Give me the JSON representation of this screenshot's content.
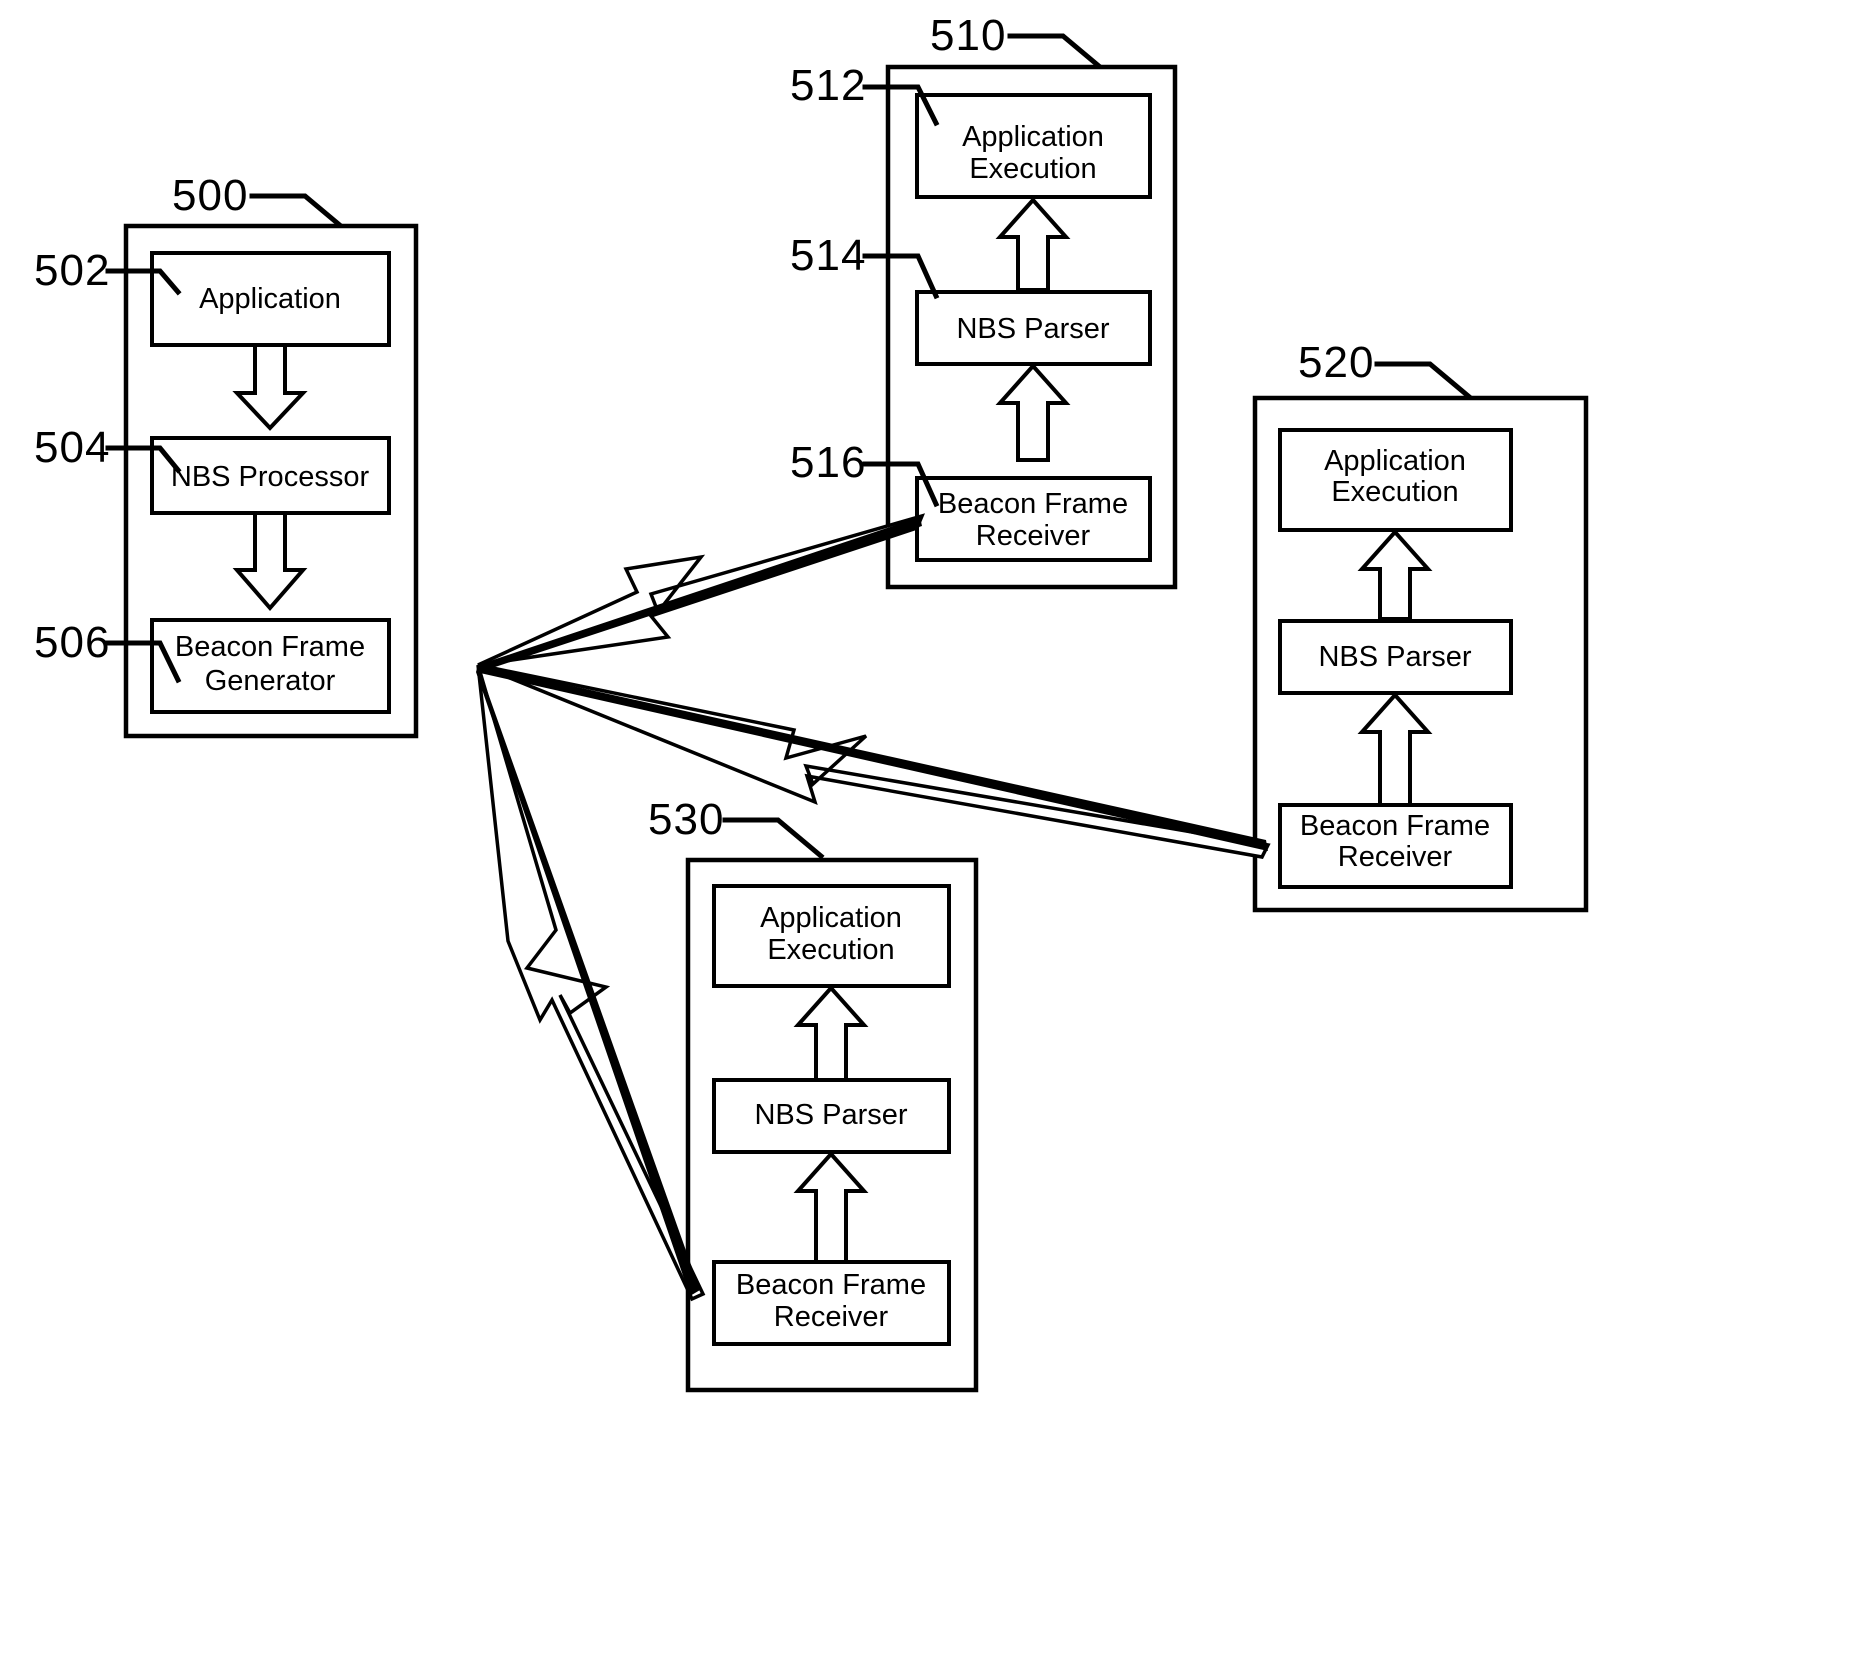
{
  "figure": {
    "title": "Beacon frame based network broadcast system diagram",
    "background_color": "#ffffff",
    "line_color": "#000000"
  },
  "nodes": {
    "transmitter": {
      "ref": "500",
      "children": [
        {
          "ref": "502",
          "label": "Application"
        },
        {
          "ref": "504",
          "label": "NBS  Processor"
        },
        {
          "ref": "506",
          "label_line1": "Beacon Frame",
          "label_line2": "Generator"
        }
      ]
    },
    "receiver_a": {
      "ref": "510",
      "children": [
        {
          "ref": "512",
          "label_line1": "Application",
          "label_line2": "Execution"
        },
        {
          "ref": "514",
          "label": "NBS Parser"
        },
        {
          "ref": "516",
          "label_line1": "Beacon Frame",
          "label_line2": "Receiver"
        }
      ]
    },
    "receiver_b": {
      "ref": "520",
      "children": [
        {
          "label_line1": "Application",
          "label_line2": "Execution"
        },
        {
          "label": "NBS Parser"
        },
        {
          "label_line1": "Beacon Frame",
          "label_line2": "Receiver"
        }
      ]
    },
    "receiver_c": {
      "ref": "530",
      "children": [
        {
          "label_line1": "Application",
          "label_line2": "Execution"
        },
        {
          "label": "NBS Parser"
        },
        {
          "label_line1": "Beacon Frame",
          "label_line2": "Receiver"
        }
      ]
    }
  },
  "wireless_links": [
    {
      "from": "506",
      "to": "516",
      "style": "lightning-bolt"
    },
    {
      "from": "506",
      "to": "520-beacon-frame-receiver",
      "style": "lightning-bolt"
    },
    {
      "from": "506",
      "to": "530-beacon-frame-receiver",
      "style": "lightning-bolt"
    }
  ],
  "internal_flows": [
    {
      "from": "502",
      "to": "504",
      "direction": "down"
    },
    {
      "from": "504",
      "to": "506",
      "direction": "down"
    },
    {
      "from": "516",
      "to": "514",
      "direction": "up"
    },
    {
      "from": "514",
      "to": "512",
      "direction": "up"
    },
    {
      "from": "520-beacon-frame-receiver",
      "to": "520-nbs-parser",
      "direction": "up"
    },
    {
      "from": "520-nbs-parser",
      "to": "520-application-execution",
      "direction": "up"
    },
    {
      "from": "530-beacon-frame-receiver",
      "to": "530-nbs-parser",
      "direction": "up"
    },
    {
      "from": "530-nbs-parser",
      "to": "530-application-execution",
      "direction": "up"
    }
  ]
}
